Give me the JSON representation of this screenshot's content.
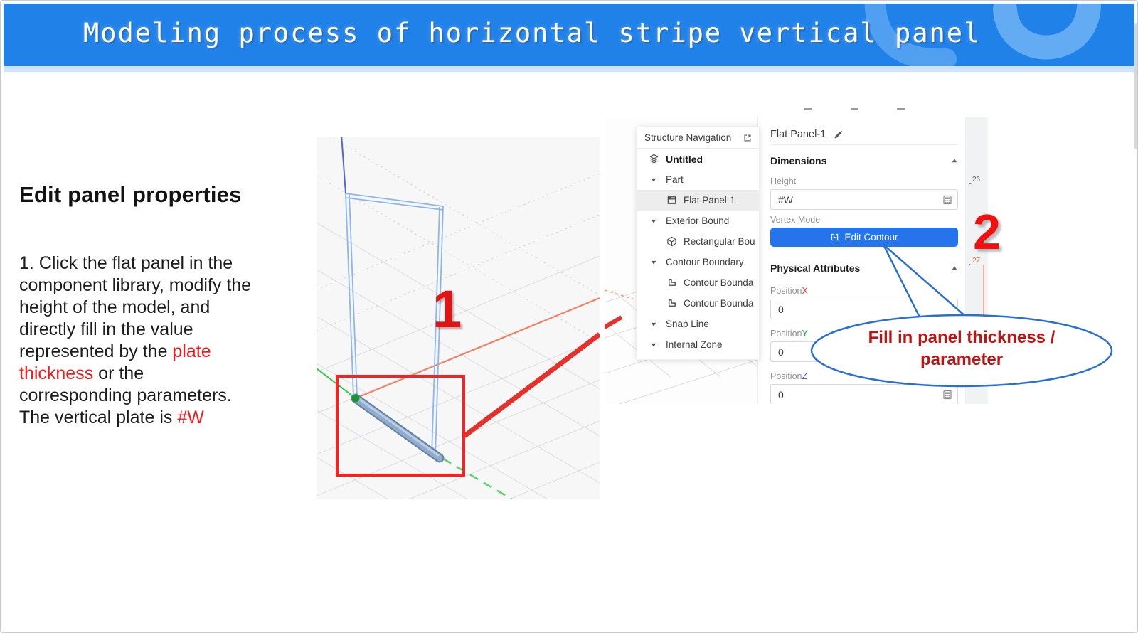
{
  "header": {
    "title": "Modeling process of horizontal stripe vertical panel"
  },
  "left_panel": {
    "heading": "Edit panel properties",
    "paragraph": [
      {
        "text": "1. Click the flat panel in the component library, modify the height of the model, and directly fill in the value represented by the ",
        "red": false
      },
      {
        "text": "plate thickness",
        "red": true
      },
      {
        "text": " or the corresponding parameters. The vertical plate is ",
        "red": false
      },
      {
        "text": "#W",
        "red": true
      }
    ]
  },
  "structure_nav": {
    "title": "Structure Navigation",
    "items": [
      {
        "icon": "layers-icon",
        "label": "Untitled",
        "level": 1,
        "bold": true
      },
      {
        "icon": "chevron-down-icon",
        "label": "Part",
        "level": 1,
        "expander": true
      },
      {
        "icon": "flat-panel-icon",
        "label": "Flat Panel-1",
        "level": 2,
        "selected": true
      },
      {
        "icon": "chevron-down-icon",
        "label": "Exterior Bound",
        "level": 1,
        "expander": true
      },
      {
        "icon": "cube-icon",
        "label": "Rectangular Bou",
        "level": 2
      },
      {
        "icon": "chevron-down-icon",
        "label": "Contour Boundary",
        "level": 1,
        "expander": true
      },
      {
        "icon": "contour-icon",
        "label": "Contour Bounda",
        "level": 2
      },
      {
        "icon": "contour-icon",
        "label": "Contour Bounda",
        "level": 2
      },
      {
        "icon": "chevron-down-icon",
        "label": "Snap Line",
        "level": 1,
        "expander": true
      },
      {
        "icon": "chevron-down-icon",
        "label": "Internal Zone",
        "level": 1,
        "expander": true
      }
    ]
  },
  "properties": {
    "name": "Flat Panel-1",
    "sections": {
      "dimensions": "Dimensions",
      "physical": "Physical Attributes"
    },
    "height_label": "Height",
    "height_value": "#W",
    "vertex_mode_label": "Vertex Mode",
    "edit_contour_label": "Edit Contour",
    "fields": [
      {
        "label_prefix": "Position",
        "axis": "X",
        "axis_class": "axis-x",
        "value": "0",
        "calc_icon": false
      },
      {
        "label_prefix": "Position",
        "axis": "Y",
        "axis_class": "axis-y",
        "value": "0",
        "calc_icon": false
      },
      {
        "label_prefix": "Position",
        "axis": "Z",
        "axis_class": "axis-z",
        "value": "0",
        "calc_icon": true
      }
    ]
  },
  "annotations": {
    "step1": "1",
    "step2": "2",
    "bubble_line1": "Fill in panel thickness /",
    "bubble_line2": "parameter",
    "margin_marks": [
      "26",
      "27"
    ]
  },
  "colors": {
    "header_blue": "#2082e9",
    "accent_blue": "#2574ec",
    "annotation_red": "#ee1c1c",
    "bubble_border_blue": "#2a6fd0",
    "bubble_text_red": "#bf1212"
  }
}
